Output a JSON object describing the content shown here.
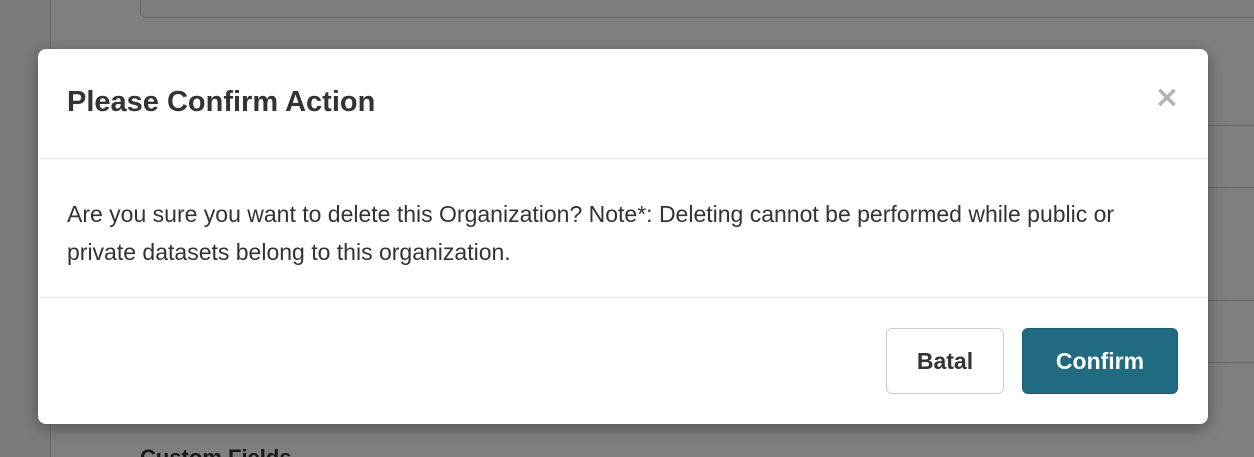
{
  "background": {
    "section_heading": "Custom Fields"
  },
  "modal": {
    "title": "Please Confirm Action",
    "close_icon": "close-icon",
    "close_glyph": "×",
    "message": "Are you sure you want to delete this Organization? Note*: Deleting cannot be performed while public or private datasets belong to this organization.",
    "cancel_label": "Batal",
    "confirm_label": "Confirm"
  },
  "colors": {
    "confirm_button": "#206b82",
    "backdrop": "rgba(0,0,0,0.5)",
    "title_text": "#333333"
  }
}
